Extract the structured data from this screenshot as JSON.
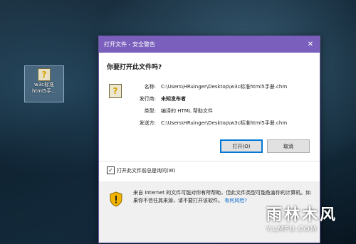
{
  "desktop": {
    "icon_label": "w3c标准\nhtml5手...",
    "icon_glyph": "?"
  },
  "dialog": {
    "title": "打开文件 - 安全警告",
    "close": "✕",
    "heading": "你要打开此文件吗?",
    "file_icon": "?",
    "fields": [
      {
        "key": "名称:",
        "value": "C:\\Users\\HRuinger\\Desktop\\w3c标准html5手册.chm",
        "bold": false
      },
      {
        "key": "发行商:",
        "value": "未知发布者",
        "bold": true
      },
      {
        "key": "类型:",
        "value": "编译的 HTML 帮助文件",
        "bold": false
      },
      {
        "key": "发送方:",
        "value": "C:\\Users\\HRuinger\\Desktop\\w3c标准html5手册.chm",
        "bold": false
      }
    ],
    "open_button": "打开(O)",
    "cancel_button": "取消",
    "checkbox_label": "打开此文件前总是询问(W)",
    "checkbox_checked": "✓",
    "warning_text": "来自 Internet 的文件可能对你有所帮助，但此文件类型可能危害你的计算机。如果你不信任其来源，请不要打开该软件。",
    "warning_link": "有何风险?",
    "accent_color": "#7a5fbd"
  },
  "watermark": {
    "brand": "雨林木风",
    "url": "Y.LMFU.COM"
  }
}
